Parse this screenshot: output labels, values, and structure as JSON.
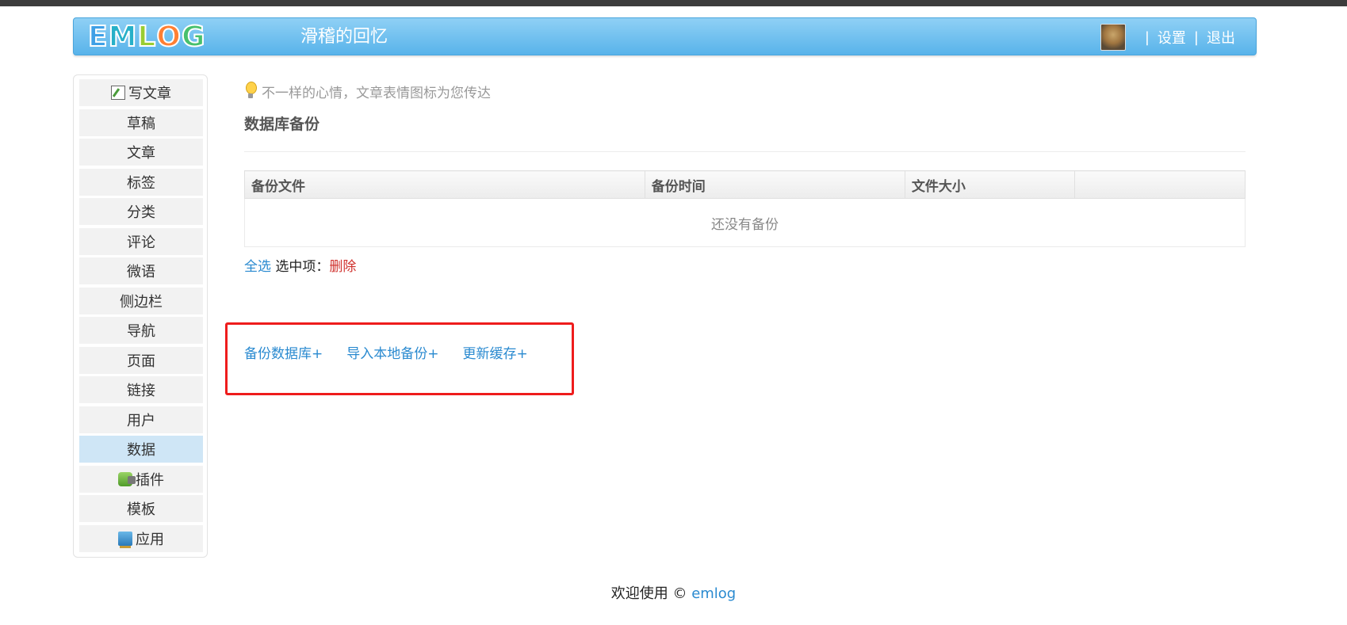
{
  "header": {
    "logo_letters": [
      {
        "ch": "E",
        "color": "#3fa0e6"
      },
      {
        "ch": "M",
        "color": "#27b0c8"
      },
      {
        "ch": "L",
        "color": "#9acd32"
      },
      {
        "ch": "O",
        "color": "#ff7f32"
      },
      {
        "ch": "G",
        "color": "#47c06d"
      }
    ],
    "site_title": "滑稽的回忆",
    "separator": "|",
    "settings_label": "设置",
    "logout_label": "退出"
  },
  "sidebar": {
    "items": [
      {
        "label": "写文章",
        "icon": "pencil-icon"
      },
      {
        "label": "草稿"
      },
      {
        "label": "文章"
      },
      {
        "label": "标签"
      },
      {
        "label": "分类"
      },
      {
        "label": "评论"
      },
      {
        "label": "微语"
      },
      {
        "label": "侧边栏"
      },
      {
        "label": "导航"
      },
      {
        "label": "页面"
      },
      {
        "label": "链接"
      },
      {
        "label": "用户"
      },
      {
        "label": "数据",
        "active": true
      },
      {
        "label": "插件",
        "icon": "plugin-icon"
      },
      {
        "label": "模板"
      },
      {
        "label": "应用",
        "icon": "app-icon"
      }
    ]
  },
  "main": {
    "tip": "不一样的心情，文章表情图标为您传达",
    "title": "数据库备份",
    "table": {
      "headers": [
        "备份文件",
        "备份时间",
        "文件大小",
        ""
      ],
      "empty_text": "还没有备份"
    },
    "select_all": "全选",
    "selected_label": "选中项：",
    "delete_label": "删除",
    "actions": {
      "backup": "备份数据库+",
      "import": "导入本地备份+",
      "update_cache": "更新缓存+"
    }
  },
  "footer": {
    "prefix": "欢迎使用 © ",
    "link": "emlog"
  },
  "colors": {
    "header_gradient_top": "#8fd0f5",
    "header_gradient_bottom": "#58b3ea",
    "link_blue": "#2a8ad0",
    "delete_red": "#d0312d",
    "highlight_box": "#ee1c1c",
    "active_menu": "#cfe6f6"
  }
}
